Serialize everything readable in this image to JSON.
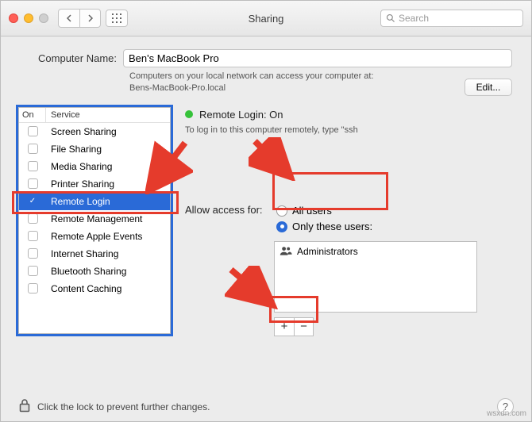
{
  "window": {
    "title": "Sharing"
  },
  "search": {
    "placeholder": "Search"
  },
  "computer_name": {
    "label": "Computer Name:",
    "value": "Ben's MacBook Pro",
    "hint1": "Computers on your local network can access your computer at:",
    "hint2": "Bens-MacBook-Pro.local",
    "edit_label": "Edit..."
  },
  "services": {
    "header_on": "On",
    "header_service": "Service",
    "items": [
      {
        "label": "Screen Sharing",
        "checked": false,
        "selected": false
      },
      {
        "label": "File Sharing",
        "checked": false,
        "selected": false
      },
      {
        "label": "Media Sharing",
        "checked": false,
        "selected": false
      },
      {
        "label": "Printer Sharing",
        "checked": false,
        "selected": false
      },
      {
        "label": "Remote Login",
        "checked": true,
        "selected": true
      },
      {
        "label": "Remote Management",
        "checked": false,
        "selected": false
      },
      {
        "label": "Remote Apple Events",
        "checked": false,
        "selected": false
      },
      {
        "label": "Internet Sharing",
        "checked": false,
        "selected": false
      },
      {
        "label": "Bluetooth Sharing",
        "checked": false,
        "selected": false
      },
      {
        "label": "Content Caching",
        "checked": false,
        "selected": false
      }
    ]
  },
  "details": {
    "status_label": "Remote Login: On",
    "hint": "To log in to this computer remotely, type \"ssh",
    "access_label": "Allow access for:",
    "radio_all": "All users",
    "radio_only": "Only these users:",
    "radio_selected": "only",
    "users": [
      {
        "label": "Administrators"
      }
    ],
    "plus": "+",
    "minus": "−"
  },
  "bottom": {
    "lock_text": "Click the lock to prevent further changes."
  },
  "watermark": "wsxdn.com"
}
